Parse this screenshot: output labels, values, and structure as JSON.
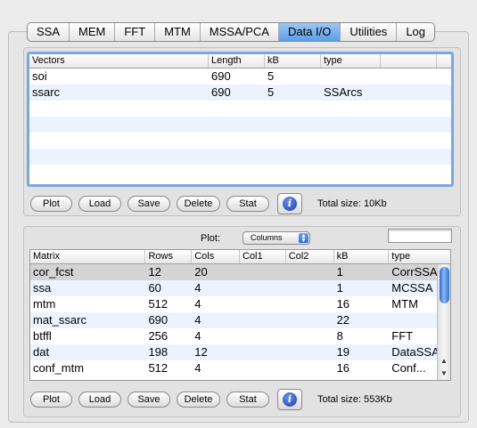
{
  "tabs": [
    {
      "label": "SSA",
      "active": false
    },
    {
      "label": "MEM",
      "active": false
    },
    {
      "label": "FFT",
      "active": false
    },
    {
      "label": "MTM",
      "active": false
    },
    {
      "label": "MSSA/PCA",
      "active": false
    },
    {
      "label": "Data I/O",
      "active": true
    },
    {
      "label": "Utilities",
      "active": false
    },
    {
      "label": "Log",
      "active": false
    }
  ],
  "vectors": {
    "headers": [
      "Vectors",
      "Length",
      "kB",
      "type"
    ],
    "rows": [
      {
        "name": "soi",
        "length": "690",
        "kb": "5",
        "type": ""
      },
      {
        "name": "ssarc",
        "length": "690",
        "kb": "5",
        "type": "SSArcs"
      }
    ],
    "buttons": [
      "Plot",
      "Load",
      "Save",
      "Delete",
      "Stat"
    ],
    "info_label": "i",
    "total": "Total size: 10Kb"
  },
  "matrix": {
    "plot_label": "Plot:",
    "plot_select": "Columns",
    "plot_field_value": "",
    "headers": [
      "Matrix",
      "Rows",
      "Cols",
      "Col1",
      "Col2",
      "kB",
      "type"
    ],
    "rows": [
      {
        "name": "cor_fcst",
        "rows": "12",
        "cols": "20",
        "col1": "",
        "col2": "",
        "kb": "1",
        "type": "CorrSSA"
      },
      {
        "name": "ssa",
        "rows": "60",
        "cols": "4",
        "col1": "",
        "col2": "",
        "kb": "1",
        "type": "MCSSA"
      },
      {
        "name": "mtm",
        "rows": "512",
        "cols": "4",
        "col1": "",
        "col2": "",
        "kb": "16",
        "type": "MTM"
      },
      {
        "name": "mat_ssarc",
        "rows": "690",
        "cols": "4",
        "col1": "",
        "col2": "",
        "kb": "22",
        "type": ""
      },
      {
        "name": "btffl",
        "rows": "256",
        "cols": "4",
        "col1": "",
        "col2": "",
        "kb": "8",
        "type": "FFT"
      },
      {
        "name": "dat",
        "rows": "198",
        "cols": "12",
        "col1": "",
        "col2": "",
        "kb": "19",
        "type": "DataSSA"
      },
      {
        "name": "conf_mtm",
        "rows": "512",
        "cols": "4",
        "col1": "",
        "col2": "",
        "kb": "16",
        "type": "Conf..."
      }
    ],
    "buttons": [
      "Plot",
      "Load",
      "Save",
      "Delete",
      "Stat"
    ],
    "info_label": "i",
    "total": "Total size: 553Kb"
  }
}
